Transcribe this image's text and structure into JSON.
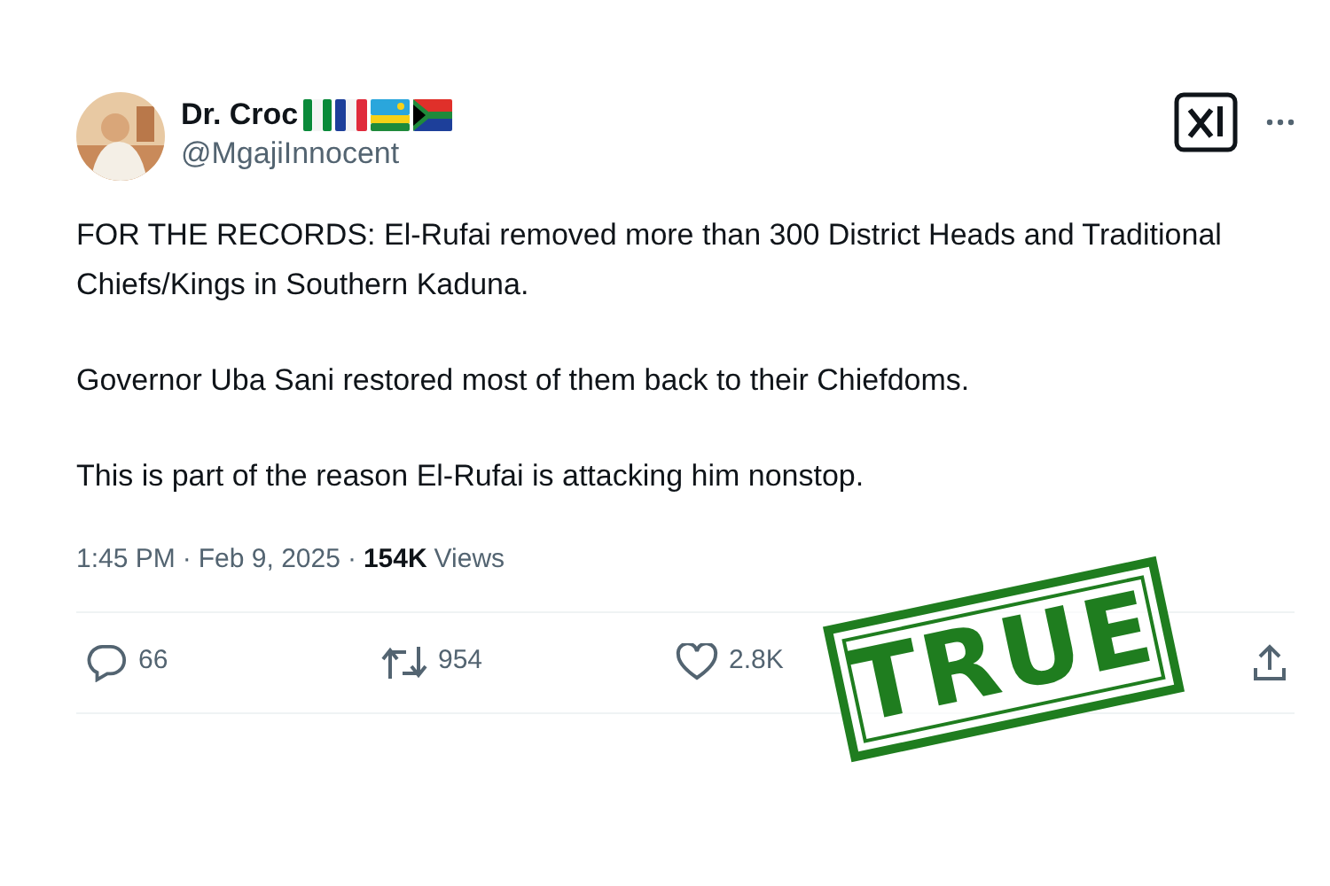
{
  "author": {
    "name": "Dr. Croc",
    "handle": "@MgajiInnocent"
  },
  "paragraphs": [
    "FOR THE RECORDS: El-Rufai removed more than 300 District Heads and Traditional Chiefs/Kings in Southern Kaduna.",
    "Governor Uba Sani restored most of them back to their Chiefdoms.",
    "This is part of the reason El-Rufai is attacking him nonstop."
  ],
  "meta": {
    "separator": "·",
    "time": "1:45 PM",
    "date": "Feb 9, 2025",
    "views_count": "154K",
    "views_label": "Views"
  },
  "actions": [
    {
      "kind": "reply",
      "count": "66"
    },
    {
      "kind": "repost",
      "count": "954"
    },
    {
      "kind": "like",
      "count": "2.8K"
    },
    {
      "kind": "share"
    }
  ],
  "stamp": {
    "text": "TRUE"
  }
}
